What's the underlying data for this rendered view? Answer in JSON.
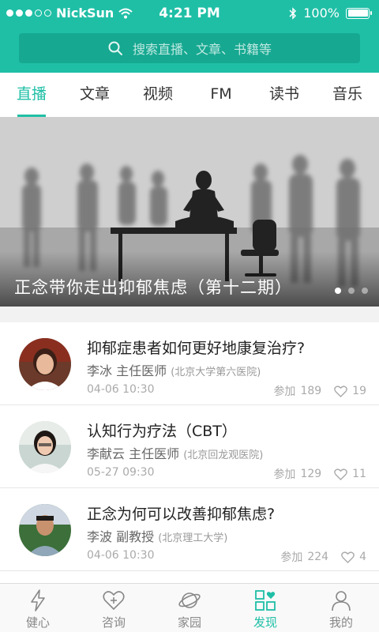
{
  "status_bar": {
    "carrier": "NickSun",
    "time": "4:21 PM",
    "battery": "100%",
    "battery_level": 1.0,
    "signal_filled": 3,
    "signal_total": 5
  },
  "search": {
    "placeholder": "搜索直播、文章、书籍等"
  },
  "tabs": [
    {
      "label": "直播",
      "active": true
    },
    {
      "label": "文章",
      "active": false
    },
    {
      "label": "视频",
      "active": false
    },
    {
      "label": "FM",
      "active": false
    },
    {
      "label": "读书",
      "active": false
    },
    {
      "label": "音乐",
      "active": false
    }
  ],
  "banner": {
    "caption": "正念带你走出抑郁焦虑（第十二期）",
    "page_count": 3,
    "current_page": 1
  },
  "articles": [
    {
      "title": "抑郁症患者如何更好地康复治疗?",
      "doctor": "李冰 主任医师",
      "hospital": "(北京大学第六医院)",
      "date": "04-06 10:30",
      "join_label": "参加",
      "join_count": "189",
      "likes": "19"
    },
    {
      "title": "认知行为疗法（CBT）",
      "doctor": "李献云 主任医师",
      "hospital": "(北京回龙观医院)",
      "date": "05-27 09:30",
      "join_label": "参加",
      "join_count": "129",
      "likes": "11"
    },
    {
      "title": "正念为何可以改善抑郁焦虑?",
      "doctor": "李波 副教授",
      "hospital": "(北京理工大学)",
      "date": "04-06 10:30",
      "join_label": "参加",
      "join_count": "224",
      "likes": "4"
    }
  ],
  "bottom_nav": [
    {
      "label": "健心",
      "icon": "lightning-icon",
      "active": false
    },
    {
      "label": "咨询",
      "icon": "heart-plus-icon",
      "active": false
    },
    {
      "label": "家园",
      "icon": "planet-icon",
      "active": false
    },
    {
      "label": "发现",
      "icon": "grid-heart-icon",
      "active": true
    },
    {
      "label": "我的",
      "icon": "person-icon",
      "active": false
    }
  ],
  "colors": {
    "accent": "#1fbfa6",
    "search_bg": "#16a891",
    "inactive": "#888888"
  }
}
